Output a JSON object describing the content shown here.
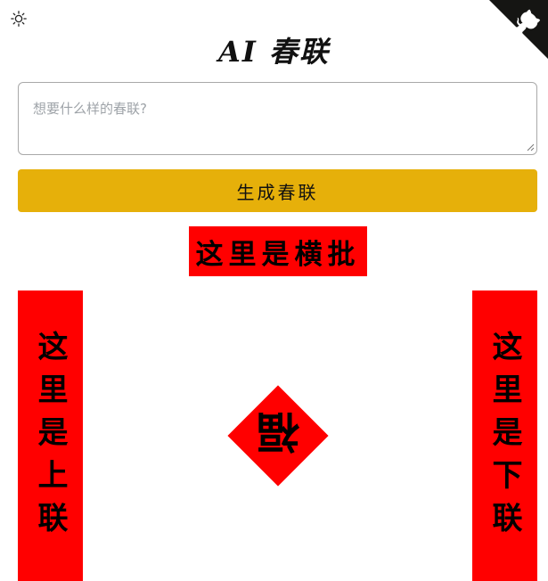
{
  "header": {
    "theme_icon": "sun-icon",
    "github_icon": "github-octocat-icon",
    "title": "AI 春联"
  },
  "prompt": {
    "placeholder": "想要什么样的春联?",
    "value": ""
  },
  "actions": {
    "generate_label": "生成春联"
  },
  "couplet": {
    "horizontal": "这里是横批",
    "upper": "这里是上联",
    "lower": "这里是下联",
    "fu": "福"
  },
  "colors": {
    "accent": "#e6b00a",
    "couplet_red": "#ff0000",
    "corner": "#151513"
  }
}
